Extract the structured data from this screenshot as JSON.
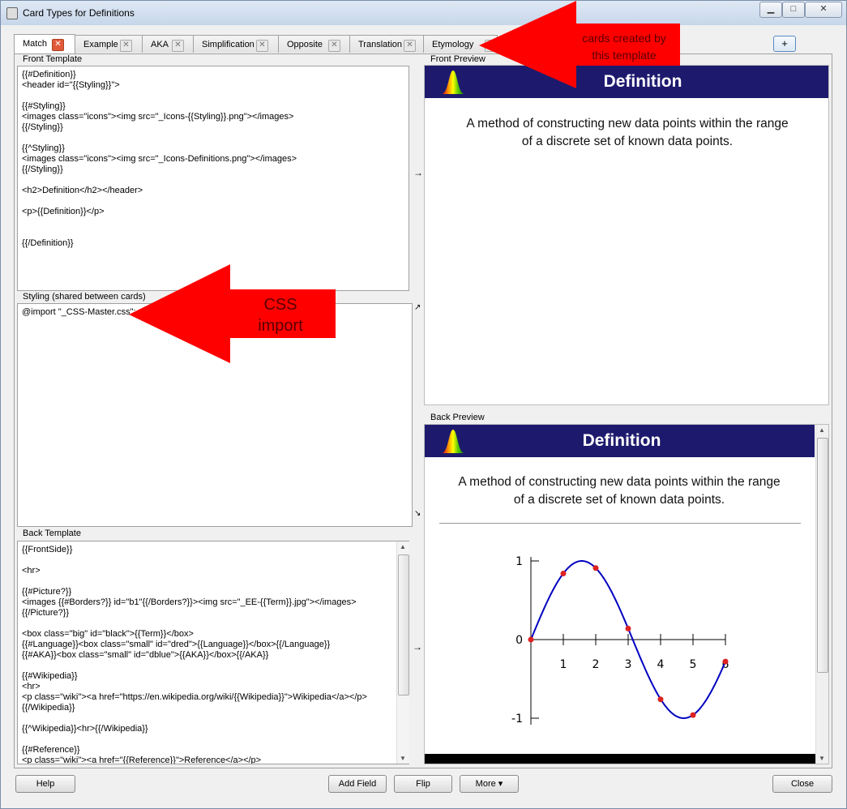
{
  "window": {
    "title": "Card Types for Definitions",
    "minimize": "▁",
    "maximize": "□",
    "close": "✕"
  },
  "tabs": [
    {
      "label": "Match",
      "close": "✕"
    },
    {
      "label": "Example",
      "close": "✕"
    },
    {
      "label": "AKA",
      "close": "✕"
    },
    {
      "label": "Simplification",
      "close": "✕"
    },
    {
      "label": "Opposite",
      "close": "✕"
    },
    {
      "label": "Translation",
      "close": "✕"
    },
    {
      "label": "Etymology",
      "close": "✕"
    }
  ],
  "add_tab": "+",
  "front_template": {
    "label": "Front Template",
    "code": "{{#Definition}}\n<header id=\"{{Styling}}\">\n\n{{#Styling}}\n<images class=\"icons\"><img src=\"_Icons-{{Styling}}.png\"></images>\n{{/Styling}}\n\n{{^Styling}}\n<images class=\"icons\"><img src=\"_Icons-Definitions.png\"></images>\n{{/Styling}}\n\n<h2>Definition</h2></header>\n\n<p>{{Definition}}</p>\n\n\n{{/Definition}}"
  },
  "styling": {
    "label": "Styling (shared between cards)",
    "code": "@import \"_CSS-Master.css\";"
  },
  "back_template": {
    "label": "Back Template",
    "code": "{{FrontSide}}\n\n<hr>\n\n{{#Picture?}}\n<images {{#Borders?}} id=\"b1\"{{/Borders?}}><img src=\"_EE-{{Term}}.jpg\"></images>\n{{/Picture?}}\n\n<box class=\"big\" id=\"black\">{{Term}}</box>\n{{#Language}}<box class=\"small\" id=\"dred\">{{Language}}</box>{{/Language}}\n{{#AKA}}<box class=\"small\" id=\"dblue\">{{AKA}}</box>{{/AKA}}\n\n{{#Wikipedia}}\n<hr>\n<p class=\"wiki\"><a href=\"https://en.wikipedia.org/wiki/{{Wikipedia}}\">Wikipedia</a></p>\n{{/Wikipedia}}\n\n{{^Wikipedia}}<hr>{{/Wikipedia}}\n\n{{#Reference}}\n<p class=\"wiki\"><a href=\"{{Reference}}\">Reference</a></p>"
  },
  "front_preview": {
    "label": "Front Preview",
    "heading": "Definition",
    "text": "A method of constructing new data points within the range of a discrete set of known data points."
  },
  "back_preview": {
    "label": "Back Preview",
    "heading": "Definition",
    "text": "A method of constructing new data points within the range of a discrete set of known data points."
  },
  "chart_data": {
    "type": "line",
    "x_ticks": [
      "1",
      "2",
      "3",
      "4",
      "5",
      "6"
    ],
    "y_ticks": [
      "1",
      "0",
      "-1"
    ],
    "xlim": [
      0,
      6
    ],
    "ylim": [
      -1,
      1
    ],
    "curve": "sin(x)",
    "points": [
      {
        "x": 0,
        "y": 0
      },
      {
        "x": 1,
        "y": 0.84
      },
      {
        "x": 2,
        "y": 0.91
      },
      {
        "x": 3,
        "y": 0.14
      },
      {
        "x": 4,
        "y": -0.76
      },
      {
        "x": 5,
        "y": -0.96
      },
      {
        "x": 6,
        "y": -0.28
      }
    ],
    "line_color": "#0000c0",
    "point_color": "#dd2222"
  },
  "annotations": {
    "cards_callout": "cards created by\nthis template",
    "css_callout": "CSS\nimport"
  },
  "buttons": {
    "help": "Help",
    "add_field": "Add Field",
    "flip": "Flip",
    "more": "More ▾",
    "close": "Close"
  },
  "colors": {
    "header_bg": "#1d1a6e",
    "callout_red": "#ff0000"
  }
}
